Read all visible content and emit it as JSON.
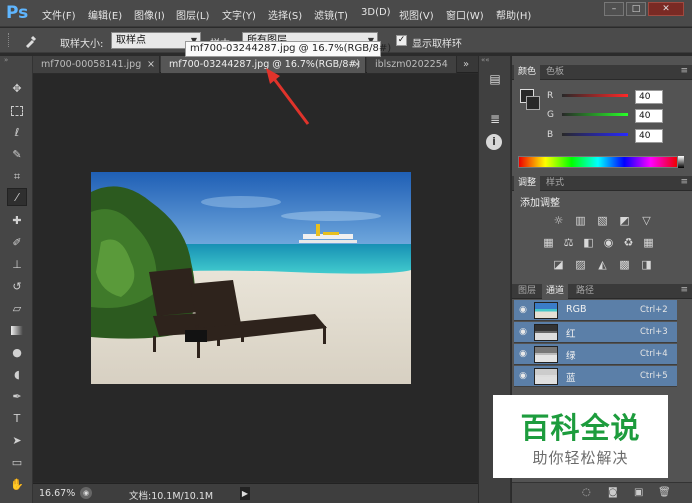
{
  "app": {
    "logo": "Ps"
  },
  "menu": [
    "文件(F)",
    "编辑(E)",
    "图像(I)",
    "图层(L)",
    "文字(Y)",
    "选择(S)",
    "滤镜(T)",
    "3D(D)",
    "视图(V)",
    "窗口(W)",
    "帮助(H)"
  ],
  "window_controls": {
    "minimize": "–",
    "restore": "□",
    "close": "✕"
  },
  "options": {
    "sample_size_label": "取样大小:",
    "sample_size_value": "取样点",
    "sample_label": "样本:",
    "sample_value": "所有图层",
    "show_ring_label": "显示取样环",
    "show_ring_checked": true
  },
  "tooltip": "mf700-03244287.jpg @ 16.7%(RGB/8#)",
  "tabs": [
    {
      "label": "mf700-00058141.jpg",
      "close": "×"
    },
    {
      "label": "mf700-03244287.jpg @ 16.7%(RGB/8#)",
      "close": "×"
    },
    {
      "label": "iblszm0202254"
    }
  ],
  "tabs_overflow": "»",
  "status": {
    "zoom": "16.67%",
    "doc": "文档:10.1M/10.1M"
  },
  "color_panel": {
    "tabs": [
      "颜色",
      "色板"
    ],
    "channels": [
      {
        "label": "R",
        "value": "40"
      },
      {
        "label": "G",
        "value": "40"
      },
      {
        "label": "B",
        "value": "40"
      }
    ]
  },
  "adjust_panel": {
    "tabs": [
      "调整",
      "样式"
    ],
    "title": "添加调整"
  },
  "channels_panel": {
    "tabs": [
      "图层",
      "通道",
      "路径"
    ],
    "rows": [
      {
        "name": "RGB",
        "key": "Ctrl+2"
      },
      {
        "name": "红",
        "key": "Ctrl+3"
      },
      {
        "name": "绿",
        "key": "Ctrl+4"
      },
      {
        "name": "蓝",
        "key": "Ctrl+5"
      }
    ]
  },
  "watermark": {
    "main": "百科全说",
    "sub": "助你轻松解决"
  }
}
